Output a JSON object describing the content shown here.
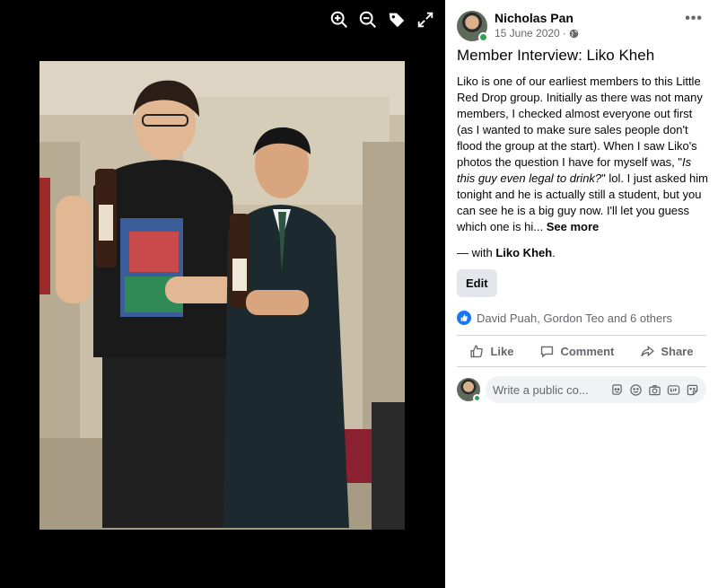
{
  "viewer": {
    "toolbar": [
      {
        "name": "zoom-in-icon"
      },
      {
        "name": "zoom-out-icon"
      },
      {
        "name": "tag-icon"
      },
      {
        "name": "fullscreen-icon"
      }
    ]
  },
  "post": {
    "author": "Nicholas Pan",
    "date": "15 June 2020",
    "separator": "·",
    "audience_icon": "globe-icon",
    "more_label": "•••",
    "title": "Member Interview: Liko Kheh",
    "body_part1": "Liko is one of our earliest members to this Little Red Drop group. Initially as there was not many members, I checked almost everyone out first (as I wanted to make sure sales people don't flood the group at the start). When I saw Liko's photos the question I have for myself was, \"",
    "body_italic": "Is this guy even legal to drink?",
    "body_part2": "\" lol. I just asked him tonight and he is actually still a student, but you can see he is a big guy now. I'll let you guess which one is hi...",
    "see_more": "See more",
    "with_prefix": "— with ",
    "with_name": "Liko Kheh",
    "with_suffix": ".",
    "edit_label": "Edit",
    "reactions_text": "David Puah, Gordon Teo and 6 others"
  },
  "actions": {
    "like": "Like",
    "comment": "Comment",
    "share": "Share"
  },
  "comment_box": {
    "placeholder": "Write a public co..."
  },
  "colors": {
    "accent": "#1877f2",
    "online": "#31a24c",
    "muted": "#65676b"
  }
}
